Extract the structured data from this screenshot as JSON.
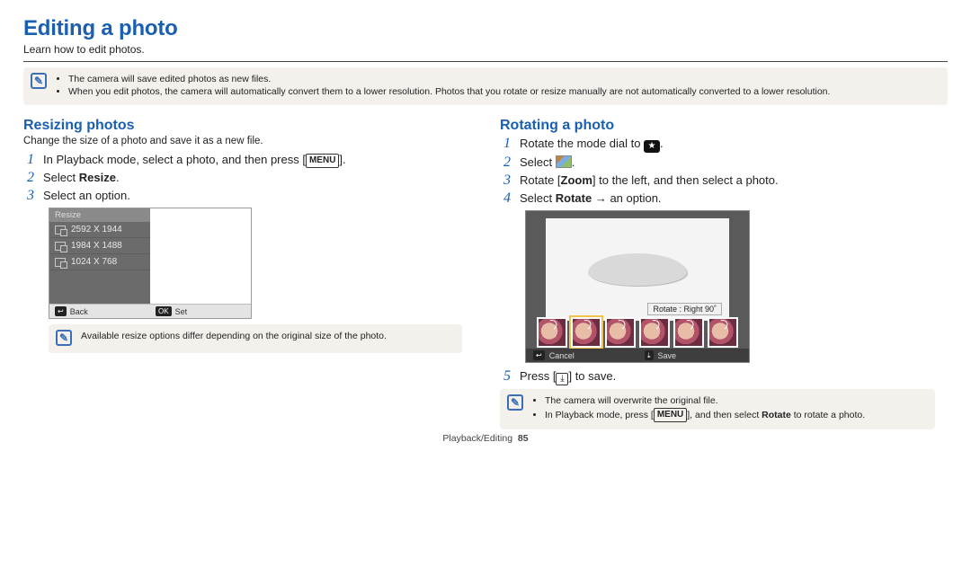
{
  "title": "Editing a photo",
  "intro": "Learn how to edit photos.",
  "top_note": {
    "items": [
      "The camera will save edited photos as new files.",
      "When you edit photos, the camera will automatically convert them to a lower resolution. Photos that you rotate or resize manually are not automatically converted to a lower resolution."
    ]
  },
  "resizing": {
    "heading": "Resizing photos",
    "subhead": "Change the size of a photo and save it as a new file.",
    "step1_a": "In Playback mode, select a photo, and then press [",
    "step1_b": "].",
    "menu_chip": "MENU",
    "step2_a": "Select ",
    "step2_bold": "Resize",
    "step2_b": ".",
    "step3": "Select an option.",
    "ui": {
      "header": "Resize",
      "options": [
        "2592 X 1944",
        "1984 X 1488",
        "1024 X 768"
      ],
      "back": "Back",
      "set": "Set",
      "back_key": "↩",
      "set_key": "OK"
    },
    "note": "Available resize options differ depending on the original size of the photo."
  },
  "rotating": {
    "heading": "Rotating a photo",
    "step1_a": "Rotate the mode dial to ",
    "step1_b": ".",
    "mode_chip": "★",
    "step2_a": "Select ",
    "step2_b": ".",
    "step3_a": "Rotate [",
    "step3_bold": "Zoom",
    "step3_b": "] to the left, and then select a photo.",
    "step4_a": "Select ",
    "step4_bold": "Rotate",
    "step4_arrow": " → ",
    "step4_b": "an option.",
    "ui": {
      "label": "Rotate : Right 90˚",
      "cancel": "Cancel",
      "save": "Save",
      "cancel_key": "↩",
      "save_key": "⤓"
    },
    "step5_a": "Press [",
    "step5_b": "] to save.",
    "save_chip": "⤓",
    "note_items_a1": "The camera will overwrite the original file.",
    "note_items_b1": "In Playback mode, press [",
    "note_items_b2": "], and then select ",
    "note_items_b_bold": "Rotate",
    "note_items_b3": " to rotate a photo."
  },
  "footer": {
    "section": "Playback/Editing",
    "page": "85"
  }
}
